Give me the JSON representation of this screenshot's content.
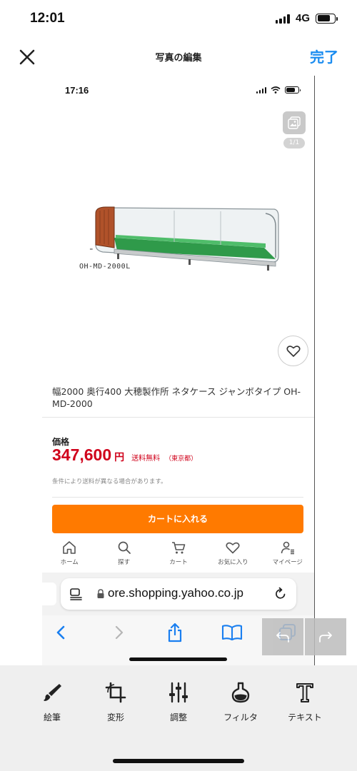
{
  "status_bar": {
    "time": "12:01",
    "network": "4G"
  },
  "editor": {
    "title": "写真の編集",
    "done_label": "完了",
    "close_icon": "close-icon"
  },
  "photo": {
    "status_time": "17:16",
    "image_counter": "1/1",
    "model_label": "OH-MD-2000L",
    "product_title": "幅2000 奥行400 大穂製作所 ネタケース ジャンボタイプ OH-MD-2000",
    "price_label": "価格",
    "price_value": "347,600",
    "price_unit": "円",
    "shipping": "送料無料",
    "shipping_region": "（東京都）",
    "shipping_note": "条件により送料が異なる場合があります。",
    "cart_button": "カートに入れる",
    "tabs": [
      {
        "label": "ホーム",
        "icon": "home-icon"
      },
      {
        "label": "探す",
        "icon": "search-icon"
      },
      {
        "label": "カート",
        "icon": "cart-icon"
      },
      {
        "label": "お気に入り",
        "icon": "heart-icon"
      },
      {
        "label": "マイページ",
        "icon": "user-icon"
      }
    ],
    "url": "ore.shopping.yahoo.co.jp"
  },
  "tools": [
    {
      "label": "絵筆",
      "icon": "brush-icon"
    },
    {
      "label": "変形",
      "icon": "crop-icon"
    },
    {
      "label": "調整",
      "icon": "sliders-icon"
    },
    {
      "label": "フィルタ",
      "icon": "filter-icon"
    },
    {
      "label": "テキスト",
      "icon": "text-icon"
    }
  ],
  "colors": {
    "accent_blue": "#1a8cf0",
    "price_red": "#d0021b",
    "cart_orange": "#ff7a00",
    "browser_blue": "#1a7ff0"
  }
}
